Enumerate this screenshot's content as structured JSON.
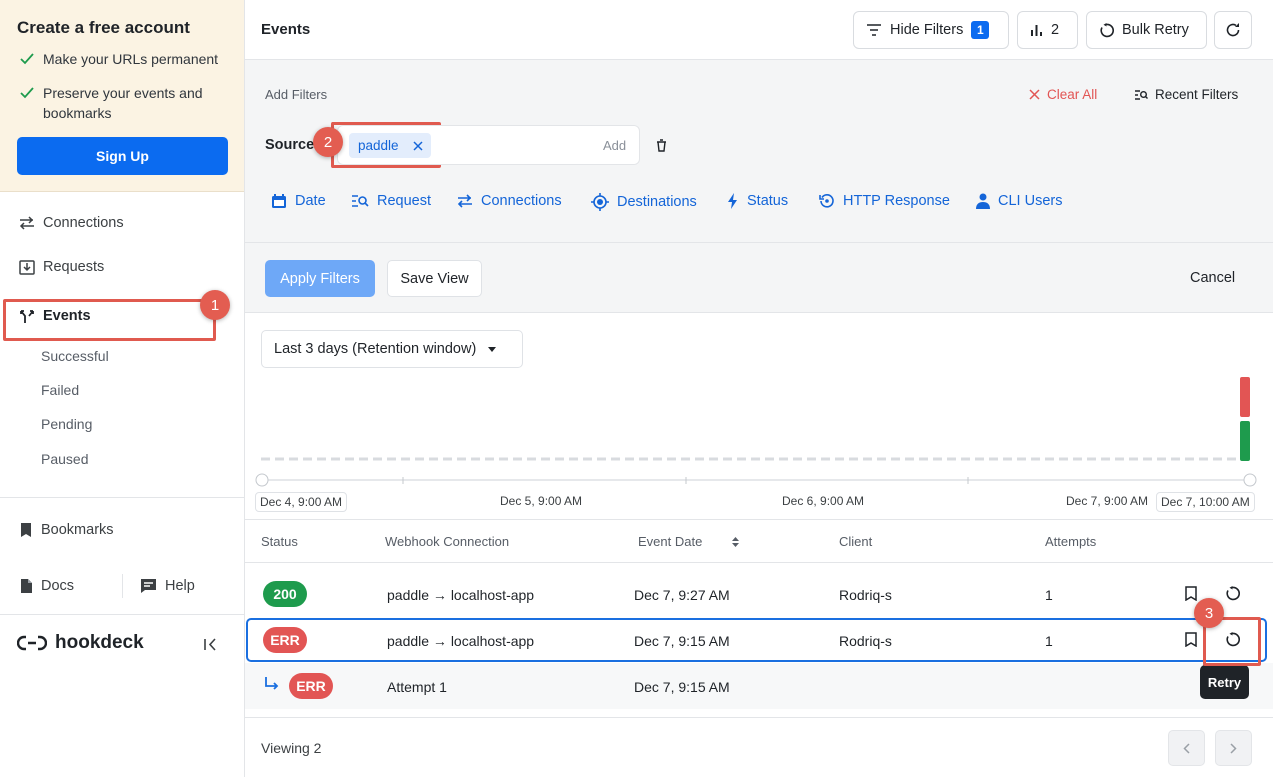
{
  "sidebar": {
    "promo": {
      "title": "Create a free account",
      "bullets": [
        "Make your URLs permanent",
        "Preserve your events and bookmarks"
      ],
      "signup": "Sign Up"
    },
    "nav": {
      "connections": "Connections",
      "requests": "Requests",
      "events": "Events",
      "sub": [
        "Successful",
        "Failed",
        "Pending",
        "Paused"
      ],
      "bookmarks": "Bookmarks",
      "docs": "Docs",
      "help": "Help"
    },
    "brand": "hookdeck"
  },
  "header": {
    "title": "Events",
    "hide_filters": "Hide Filters",
    "hide_filters_count": "1",
    "chart_count": "2",
    "bulk_retry": "Bulk Retry"
  },
  "filters": {
    "add_filters": "Add Filters",
    "clear_all": "Clear All",
    "recent_filters": "Recent Filters",
    "source_label": "Source:",
    "source_tag": "paddle",
    "add_placeholder": "Add",
    "chips": [
      "Date",
      "Request",
      "Connections",
      "Destinations",
      "Status",
      "HTTP Response",
      "CLI Users"
    ],
    "apply": "Apply Filters",
    "save_view": "Save View",
    "cancel": "Cancel"
  },
  "timeline": {
    "range": "Last 3 days (Retention window)",
    "ticks": [
      "Dec 4, 9:00 AM",
      "Dec 5, 9:00 AM",
      "Dec 6, 9:00 AM",
      "Dec 7, 9:00 AM",
      "Dec 7, 10:00 AM"
    ]
  },
  "table": {
    "columns": [
      "Status",
      "Webhook Connection",
      "Event Date",
      "Client",
      "Attempts"
    ],
    "rows": [
      {
        "status": "200",
        "connection": "paddle → localhost-app",
        "date": "Dec 7, 9:27 AM",
        "client": "Rodriq-s",
        "attempts": "1"
      },
      {
        "status": "ERR",
        "connection": "paddle → localhost-app",
        "date": "Dec 7, 9:15 AM",
        "client": "Rodriq-s",
        "attempts": "1"
      },
      {
        "status": "ERR",
        "connection": "Attempt 1",
        "date": "Dec 7, 9:15 AM"
      }
    ],
    "tooltip": "Retry",
    "viewing": "Viewing 2"
  },
  "annotations": [
    "1",
    "2",
    "3"
  ],
  "colors": {
    "accent": "#0b6bf0",
    "success": "#1e9b4d",
    "error": "#e25554",
    "annotation": "#e05a4f"
  }
}
